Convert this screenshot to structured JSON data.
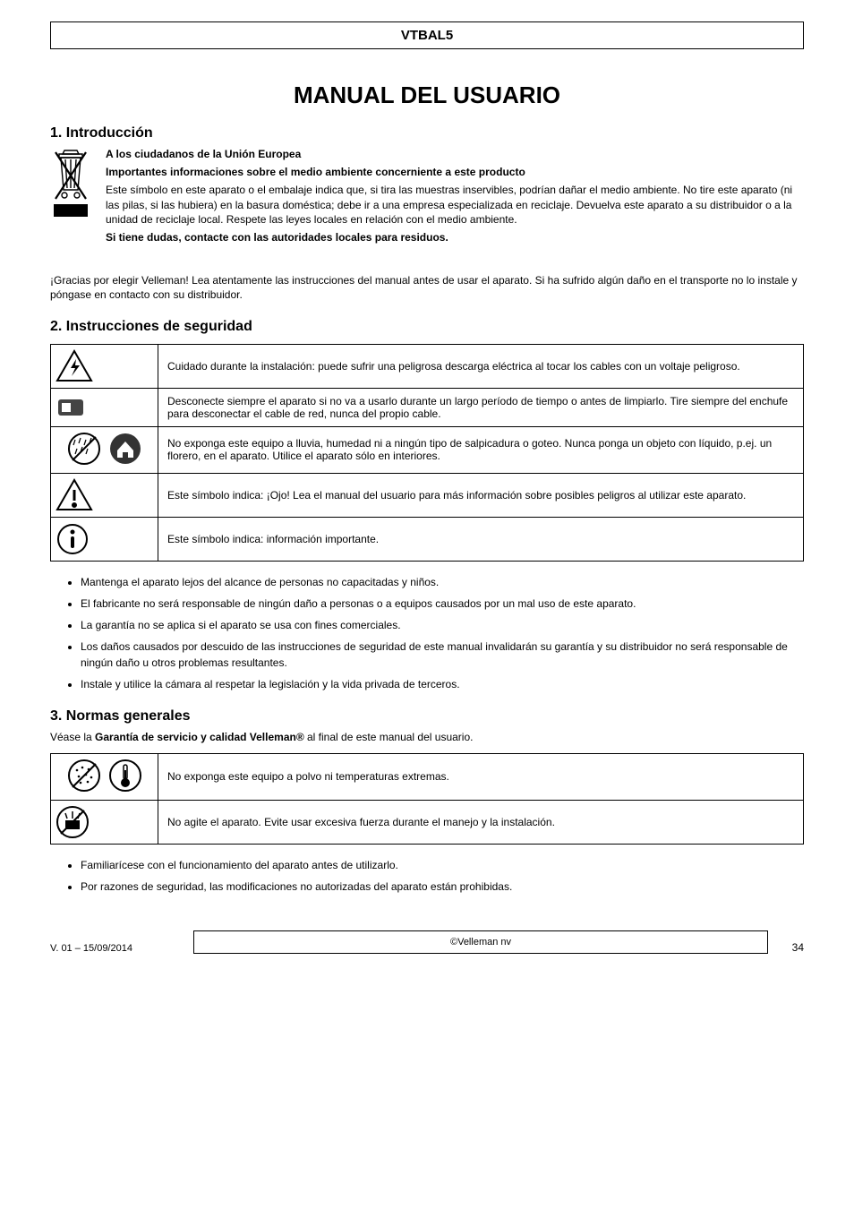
{
  "header": {
    "model": "VTBAL5"
  },
  "title": "MANUAL DEL USUARIO",
  "section1": {
    "heading": "1. Introducción",
    "greeting": "A los ciudadanos de la Unión Europea",
    "notice_bold": "Importantes informaciones sobre el medio ambiente concerniente a este producto",
    "p1": "Este símbolo en este aparato o el embalaje indica que, si tira las muestras inservibles, podrían dañar el medio ambiente. No tire este aparato (ni las pilas, si las hubiera) en la basura doméstica; debe ir a una empresa especializada en reciclaje. Devuelva este aparato a su distribuidor o a la unidad de reciclaje local. Respete las leyes locales en relación con el medio ambiente.",
    "p2_bold": "Si tiene dudas, contacte con las autoridades locales para residuos.",
    "thanks": "¡Gracias por elegir Velleman! Lea atentamente las instrucciones del manual antes de usar el aparato. Si ha sufrido algún daño en el transporte no lo instale y póngase en contacto con su distribuidor."
  },
  "section2": {
    "heading": "2. Instrucciones de seguridad",
    "rows": [
      {
        "icon": "hv-triangle",
        "text": "Cuidado durante la instalación: puede sufrir una peligrosa descarga eléctrica al tocar los cables con un voltaje peligroso."
      },
      {
        "icon": "unplug",
        "text": "Desconecte siempre el aparato si no va a usarlo durante un largo período de tiempo o antes de limpiarlo. Tire siempre del enchufe para desconectar el cable de red, nunca del propio cable."
      },
      {
        "icon": "no-rain-indoor",
        "text": "No exponga este equipo a lluvia, humedad ni a ningún tipo de salpicadura o goteo. Nunca ponga un objeto con líquido, p.ej. un florero, en el aparato. Utilice el aparato sólo en interiores."
      },
      {
        "icon": "warn-triangle",
        "text": "Este símbolo indica: ¡Ojo! Lea el manual del usuario para más información sobre posibles peligros al utilizar este aparato."
      },
      {
        "icon": "notice-circle",
        "text": "Este símbolo indica: información importante."
      }
    ],
    "bullets": [
      "Mantenga el aparato lejos del alcance de personas no capacitadas y niños.",
      "El fabricante no será responsable de ningún daño a personas o a equipos causados por un mal uso de este aparato.",
      "La garantía no se aplica si el aparato se usa con fines comerciales.",
      "Los daños causados por descuido de las instrucciones de seguridad de este manual invalidarán su garantía y su distribuidor no será responsable de ningún daño u otros problemas resultantes.",
      "Instale y utilice la cámara al respetar la legislación y la vida privada de terceros."
    ]
  },
  "section3": {
    "heading": "3. Normas generales",
    "ref": "Véase la Garantía de servicio y calidad Velleman® al final de este manual del usuario.",
    "rows": [
      {
        "icon": "no-dust-temp",
        "text": "No exponga este equipo a polvo ni temperaturas extremas."
      },
      {
        "icon": "no-shock",
        "text": "No agite el aparato. Evite usar excesiva fuerza durante el manejo y la instalación."
      }
    ],
    "bullets2": [
      "Familiarícese con el funcionamiento del aparato antes de utilizarlo.",
      "Por razones de seguridad, las modificaciones no autorizadas del aparato están prohibidas."
    ]
  },
  "footer": {
    "text": "V. 01 – 15/09/2014",
    "copyright": "©Velleman nv",
    "page": "34"
  }
}
